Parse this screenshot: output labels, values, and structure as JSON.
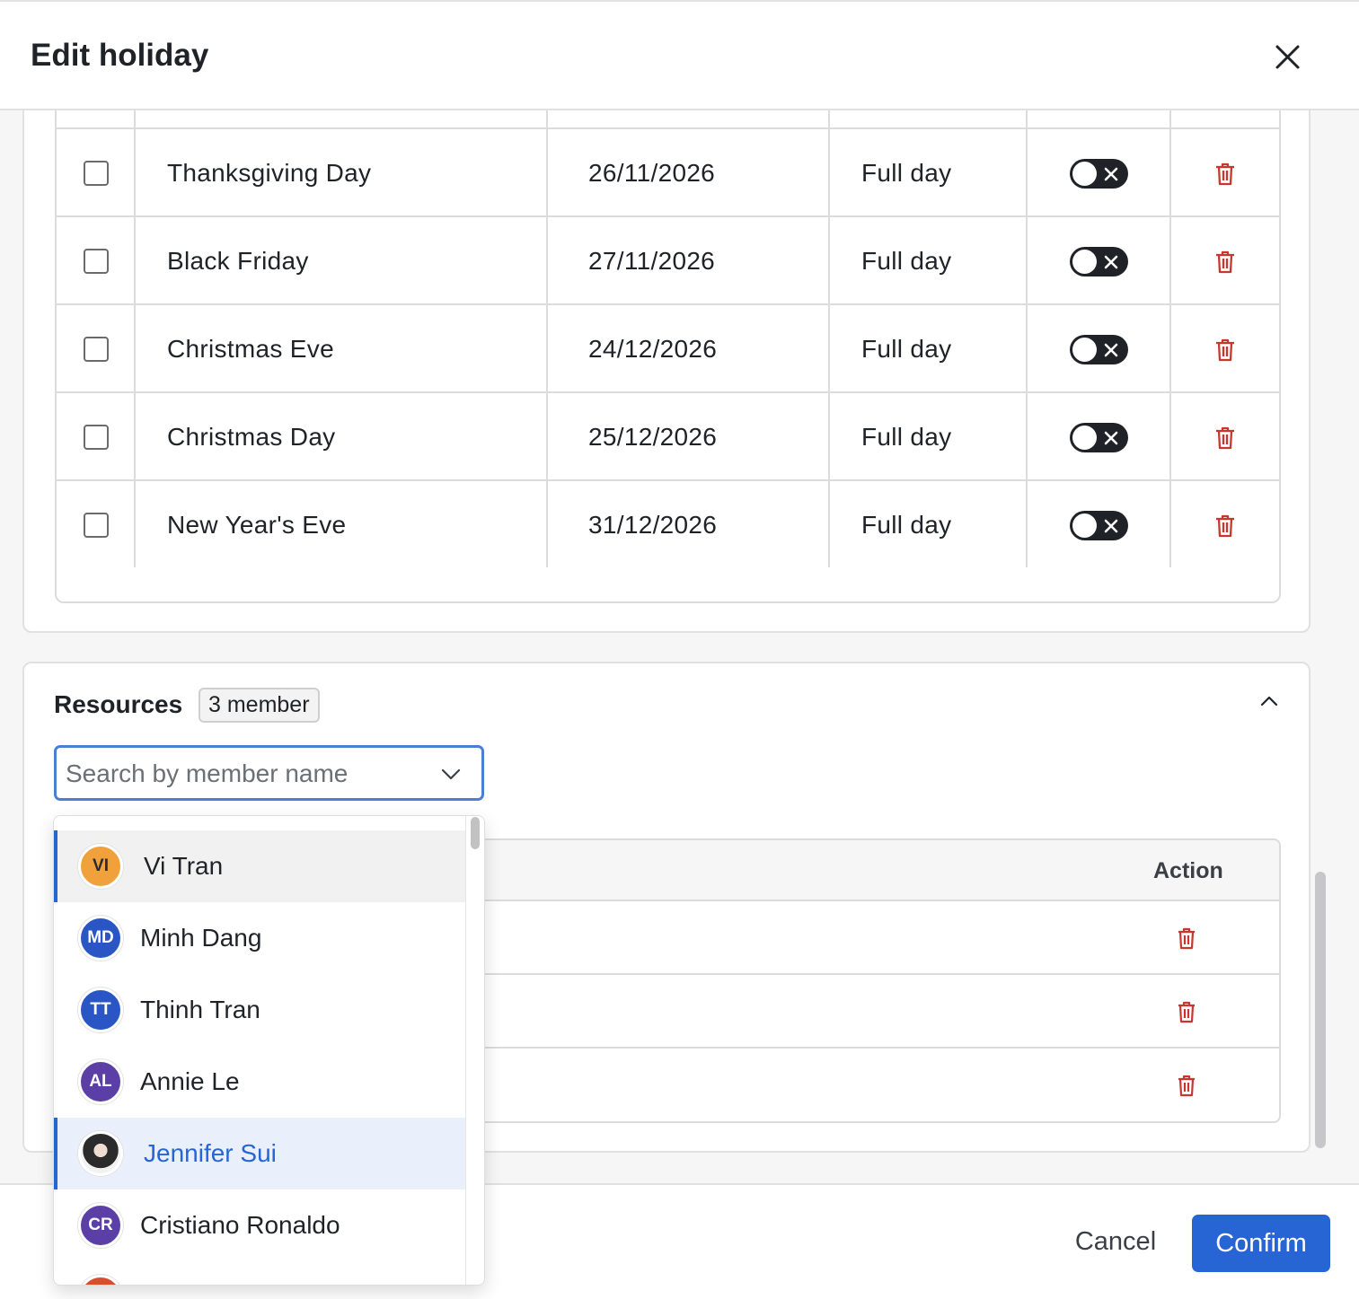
{
  "dialog": {
    "title": "Edit holiday"
  },
  "holidays": [
    {
      "name": "Thanksgiving Day",
      "date": "26/11/2026",
      "type": "Full day"
    },
    {
      "name": "Black Friday",
      "date": "27/11/2026",
      "type": "Full day"
    },
    {
      "name": "Christmas Eve",
      "date": "24/12/2026",
      "type": "Full day"
    },
    {
      "name": "Christmas Day",
      "date": "25/12/2026",
      "type": "Full day"
    },
    {
      "name": "New Year's Eve",
      "date": "31/12/2026",
      "type": "Full day"
    }
  ],
  "resources": {
    "title": "Resources",
    "badge": "3 member",
    "search_placeholder": "Search by member name",
    "table": {
      "action_header": "Action"
    }
  },
  "dropdown": {
    "options": [
      {
        "initials": "VI",
        "name": "Vi Tran",
        "color": "#f0a13b",
        "text_color": "#2a2a2a"
      },
      {
        "initials": "MD",
        "name": "Minh Dang",
        "color": "#2a55c4",
        "text_color": "#ffffff"
      },
      {
        "initials": "TT",
        "name": "Thinh Tran",
        "color": "#2a55c4",
        "text_color": "#ffffff"
      },
      {
        "initials": "AL",
        "name": "Annie Le",
        "color": "#5b3fa6",
        "text_color": "#ffffff"
      },
      {
        "initials": "",
        "name": "Jennifer Sui",
        "color": "#3a3a3a",
        "text_color": "#ffffff"
      },
      {
        "initials": "CR",
        "name": "Cristiano Ronaldo",
        "color": "#5b3fa6",
        "text_color": "#ffffff"
      },
      {
        "initials": "",
        "name": "",
        "color": "#d4502a",
        "text_color": "#ffffff"
      }
    ]
  },
  "footer": {
    "cancel_label": "Cancel",
    "confirm_label": "Confirm"
  },
  "colors": {
    "accent": "#2764d4",
    "danger": "#c8372d",
    "toggle": "#1f2328"
  }
}
